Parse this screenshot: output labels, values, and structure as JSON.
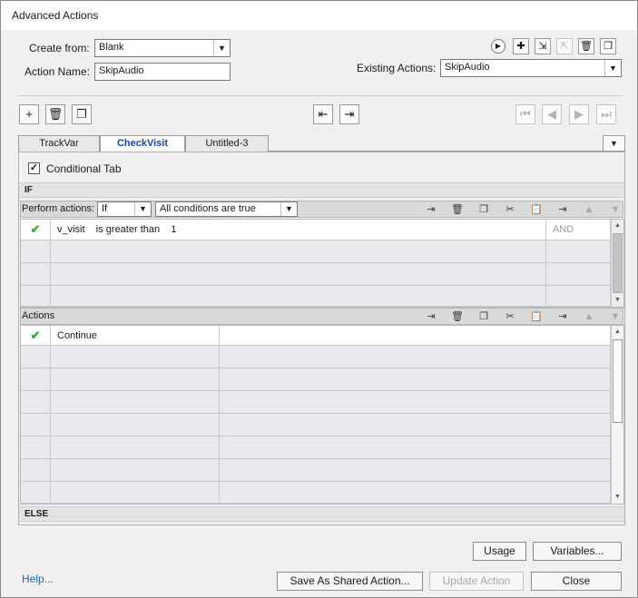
{
  "window": {
    "title": "Advanced Actions"
  },
  "header": {
    "create_from_label": "Create from:",
    "create_from_value": "Blank",
    "action_name_label": "Action Name:",
    "action_name_value": "SkipAudio",
    "existing_actions_label": "Existing Actions:",
    "existing_actions_value": "SkipAudio"
  },
  "tabs": [
    {
      "label": "TrackVar",
      "active": false
    },
    {
      "label": "CheckVisit",
      "active": true
    },
    {
      "label": "Untitled-3",
      "active": false
    }
  ],
  "conditional": {
    "label": "Conditional Tab",
    "checked": true
  },
  "if_section": {
    "header": "IF",
    "perform_actions_label": "Perform actions:",
    "perform_actions_value": "If",
    "condition_mode_value": "All conditions are true",
    "rows": [
      {
        "enabled": true,
        "expression": "v_visit    is greater than    1",
        "operator": "AND"
      }
    ]
  },
  "actions_section": {
    "header": "Actions",
    "rows": [
      {
        "enabled": true,
        "action": "Continue",
        "target": ""
      }
    ]
  },
  "else_section": {
    "header": "ELSE"
  },
  "footer": {
    "usage": "Usage",
    "variables": "Variables...",
    "help": "Help...",
    "save_shared": "Save As Shared Action...",
    "update": "Update Action",
    "close": "Close"
  },
  "icons": {
    "check_color": "#2eae2e",
    "active_tab_color": "#1b3fb8",
    "link_color": "#1b63c9"
  }
}
